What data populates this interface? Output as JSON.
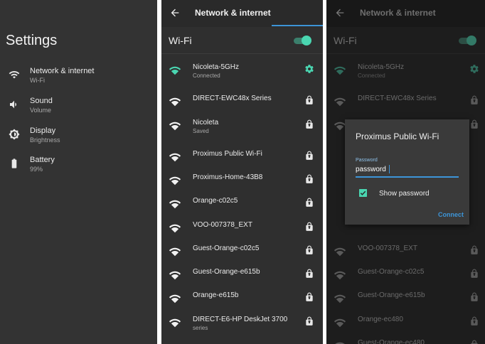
{
  "colors": {
    "accent_teal": "#4ad6b1",
    "accent_blue": "#3d95d8",
    "panel_bg": "#333333"
  },
  "settings": {
    "title": "Settings",
    "items": [
      {
        "label": "Network & internet",
        "sub": "Wi-Fi",
        "icon": "wifi-icon"
      },
      {
        "label": "Sound",
        "sub": "Volume",
        "icon": "volume-icon"
      },
      {
        "label": "Display",
        "sub": "Brightness",
        "icon": "brightness-icon"
      },
      {
        "label": "Battery",
        "sub": "99%",
        "icon": "battery-icon"
      }
    ]
  },
  "network_screen": {
    "title": "Network & internet",
    "wifi_label": "Wi-Fi",
    "networks": [
      {
        "name": "Nicoleta-5GHz",
        "sub": "Connected",
        "trailing": "gear-icon"
      },
      {
        "name": "DIRECT-EWC48x Series",
        "sub": "",
        "trailing": "lock-icon"
      },
      {
        "name": "Nicoleta",
        "sub": "Saved",
        "trailing": "lock-icon"
      },
      {
        "name": "Proximus Public Wi-Fi",
        "sub": "",
        "trailing": "lock-icon"
      },
      {
        "name": "Proximus-Home-43B8",
        "sub": "",
        "trailing": "lock-icon"
      },
      {
        "name": "Orange-c02c5",
        "sub": "",
        "trailing": "lock-icon"
      },
      {
        "name": "VOO-007378_EXT",
        "sub": "",
        "trailing": "lock-icon"
      },
      {
        "name": "Guest-Orange-c02c5",
        "sub": "",
        "trailing": "lock-icon"
      },
      {
        "name": "Guest-Orange-e615b",
        "sub": "",
        "trailing": "lock-icon"
      },
      {
        "name": "Orange-e615b",
        "sub": "",
        "trailing": "lock-icon"
      },
      {
        "name": "DIRECT-E6-HP DeskJet 3700",
        "sub": "series",
        "trailing": "lock-icon"
      }
    ]
  },
  "dialog_screen": {
    "title": "Network & internet",
    "wifi_label": "Wi-Fi",
    "networks": [
      {
        "name": "Nicoleta-5GHz",
        "sub": "Connected",
        "trailing": "gear-icon"
      },
      {
        "name": "DIRECT-EWC48x Series",
        "sub": "",
        "trailing": "lock-icon"
      },
      {
        "name": "Orange-c02c5",
        "sub": "",
        "trailing": "lock-icon"
      },
      {
        "name": "VOO-007378_EXT",
        "sub": "",
        "trailing": "lock-icon"
      },
      {
        "name": "Guest-Orange-c02c5",
        "sub": "",
        "trailing": "lock-icon"
      },
      {
        "name": "Guest-Orange-e615b",
        "sub": "",
        "trailing": "lock-icon"
      },
      {
        "name": "Orange-ec480",
        "sub": "",
        "trailing": "lock-icon"
      },
      {
        "name": "Guest-Orange-ec480",
        "sub": "",
        "trailing": "lock-icon"
      }
    ],
    "dialog": {
      "title": "Proximus Public Wi-Fi",
      "field_label": "Password",
      "field_value": "password",
      "show_password_label": "Show password",
      "connect_label": "Connect"
    }
  }
}
